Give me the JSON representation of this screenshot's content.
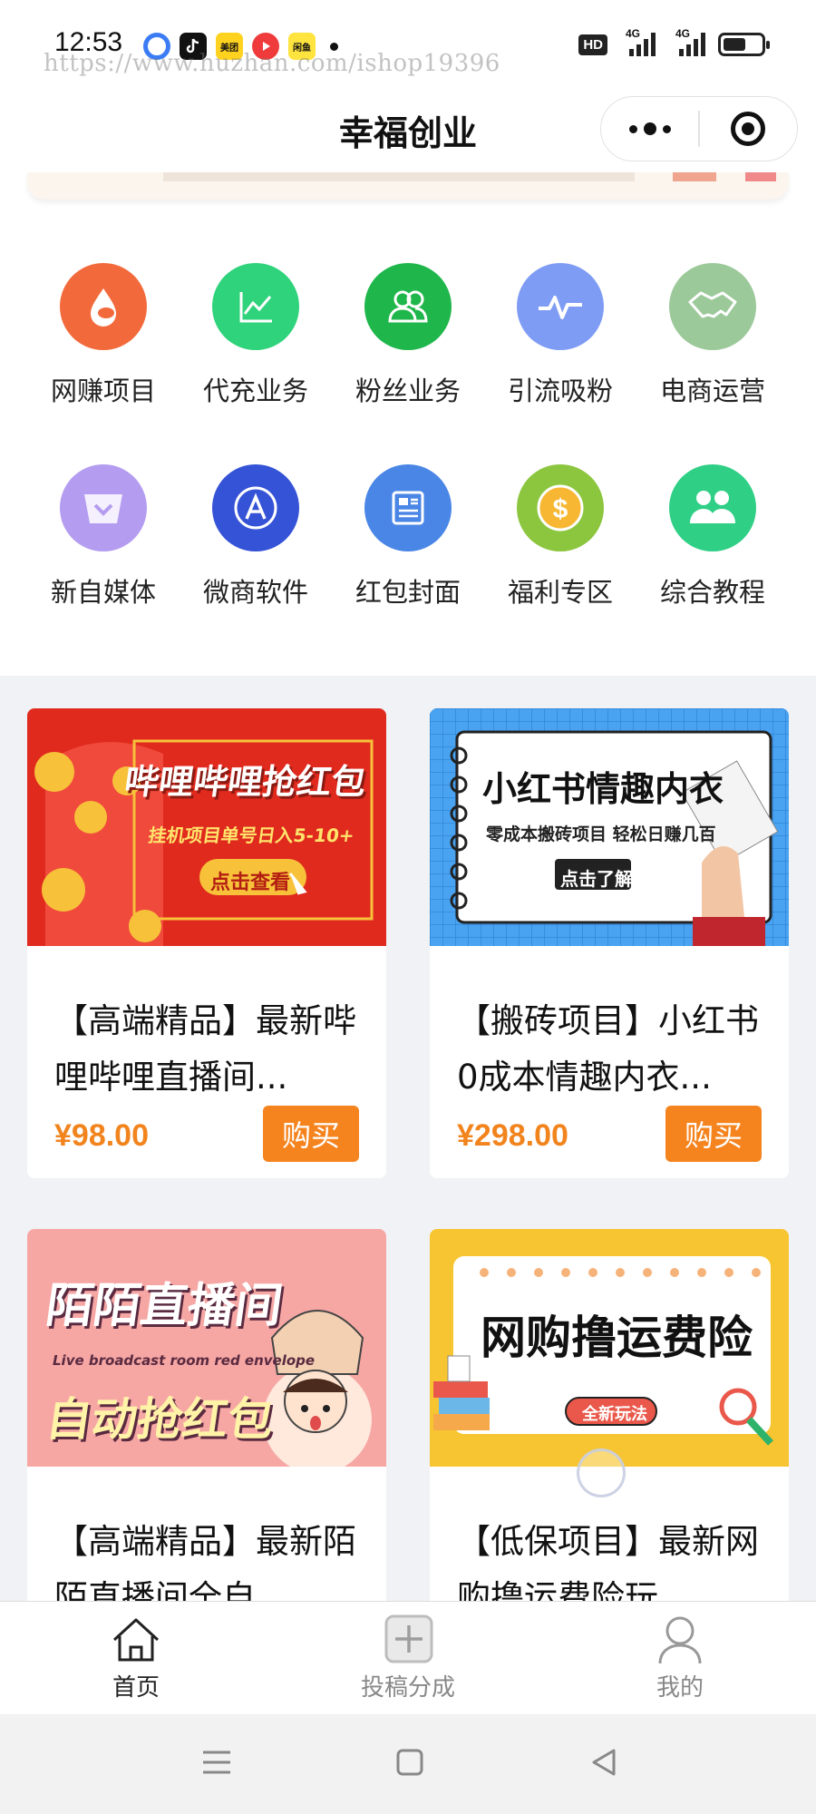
{
  "status_bar": {
    "time": "12:53",
    "watermark": "https://www.huzhan.com/ishop19396",
    "apps": [
      {
        "icon": "quark-icon",
        "color": "#3b7cf5",
        "text": ""
      },
      {
        "icon": "douyin-icon",
        "color": "#111111",
        "text": ""
      },
      {
        "icon": "meituan-icon",
        "color": "#ffd21f",
        "text": "美团"
      },
      {
        "icon": "video-icon",
        "color": "#ef3b3b",
        "text": ""
      },
      {
        "icon": "xianyu-icon",
        "color": "#ffe33f",
        "text": "闲鱼"
      }
    ],
    "hd": "HD",
    "network": "4G"
  },
  "header": {
    "title": "幸福创业"
  },
  "categories": [
    {
      "label": "网赚项目",
      "icon": "drop-icon",
      "color": "#f26a3b"
    },
    {
      "label": "代充业务",
      "icon": "line-chart-icon",
      "color": "#2fd37b"
    },
    {
      "label": "粉丝业务",
      "icon": "users-icon",
      "color": "#1fb64b"
    },
    {
      "label": "引流吸粉",
      "icon": "pulse-icon",
      "color": "#7f9cf5"
    },
    {
      "label": "电商运营",
      "icon": "handshake-icon",
      "color": "#9cc99a"
    },
    {
      "label": "新自媒体",
      "icon": "heart-badge-icon",
      "color": "#b49cf0"
    },
    {
      "label": "微商软件",
      "icon": "app-store-icon",
      "color": "#3553d6"
    },
    {
      "label": "红包封面",
      "icon": "news-icon",
      "color": "#4a86e6"
    },
    {
      "label": "福利专区",
      "icon": "dollar-coin-icon",
      "color": "#8cc63f"
    },
    {
      "label": "综合教程",
      "icon": "group-icon",
      "color": "#2fcf86"
    }
  ],
  "products": [
    {
      "title": "【高端精品】最新哔哩哔哩直播间...",
      "price": "¥98.00",
      "buy_label": "购买",
      "poster": {
        "headline": "哔哩哔哩抢红包",
        "sub": "挂机项目单号日入5-10+",
        "cta": "点击查看"
      }
    },
    {
      "title": "【搬砖项目】小红书0成本情趣内衣...",
      "price": "¥298.00",
      "buy_label": "购买",
      "poster": {
        "headline": "小红书情趣内衣",
        "sub": "零成本搬砖项目 轻松日赚几百",
        "cta": "点击了解"
      }
    },
    {
      "title": "【高端精品】最新陌陌直播间全自",
      "poster": {
        "headline": "陌陌直播间",
        "sub": "Live broadcast room red envelope",
        "cta": "自动抢红包"
      }
    },
    {
      "title": "【低保项目】最新网购撸运费险玩",
      "poster": {
        "headline": "网购撸运费险",
        "sub": "",
        "cta": "全新玩法"
      }
    }
  ],
  "tabbar": [
    {
      "label": "首页",
      "icon": "home-icon",
      "active": true
    },
    {
      "label": "投稿分成",
      "icon": "add-square-icon",
      "active": false
    },
    {
      "label": "我的",
      "icon": "user-icon",
      "active": false
    }
  ],
  "colors": {
    "accent": "#f5841f",
    "price": "#f2841e",
    "background": "#f1f2f6"
  }
}
